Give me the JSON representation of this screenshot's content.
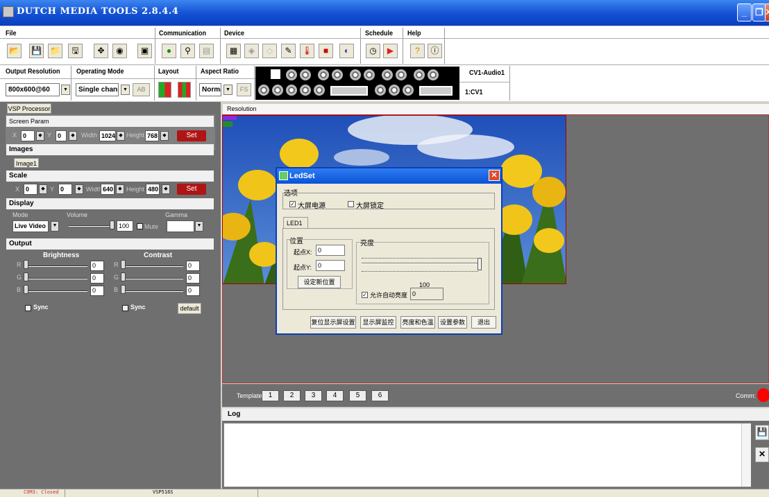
{
  "window": {
    "title": "DUTCH MEDIA TOOLS 2.8.4.4",
    "min": "_",
    "restore": "❐",
    "close": "X"
  },
  "toolbar_groups": {
    "file": "File",
    "communication": "Communication",
    "device": "Device",
    "schedule": "Schedule",
    "help": "Help"
  },
  "settings": {
    "output_resolution_label": "Output Resolution",
    "output_resolution_value": "800x600@60",
    "operating_mode_label": "Operating Mode",
    "operating_mode_value": "Single channel",
    "ab_button": "AB",
    "layout_label": "Layout",
    "aspect_ratio_label": "Aspect Ratio",
    "aspect_ratio_value": "Normal",
    "fs_button": "FS",
    "input_audio": "CV1-Audio1",
    "input_channel": "1:CV1"
  },
  "left": {
    "tab": "VSP Processor",
    "screen_param": "Screen Param",
    "x_label": "X",
    "x_value": "0",
    "y_label": "Y",
    "y_value": "0",
    "width_label": "Width",
    "width_value": "1024",
    "height_label": "Height",
    "height_value": "768",
    "set_label": "Set",
    "images": "Images",
    "image_tab": "Image1",
    "scale": "Scale",
    "scale_x": "0",
    "scale_y": "0",
    "scale_w": "640",
    "scale_h": "480",
    "display": "Display",
    "mode_label": "Mode",
    "mode_value": "Live Video",
    "volume_label": "Volume",
    "volume_value": "100",
    "mute_label": "Mute",
    "gamma_label": "Gamma",
    "output": "Output",
    "brightness": "Brightness",
    "contrast": "Contrast",
    "r": "R",
    "g": "G",
    "b": "B",
    "br_r": "0",
    "br_g": "0",
    "br_b": "0",
    "ct_r": "0",
    "ct_g": "0",
    "ct_b": "0",
    "sync": "Sync",
    "default_btn": "default"
  },
  "main": {
    "resolution_tab": "Resolution",
    "template_label": "Template:",
    "templates": [
      "1",
      "2",
      "3",
      "4",
      "5",
      "6"
    ],
    "comm_label": "Comm:",
    "log_label": "Log"
  },
  "dialog": {
    "title": "LedSet",
    "options_label": "选项",
    "opt1": "大屏电源",
    "opt2": "大屏锁定",
    "tab": "LED1",
    "position_label": "位置",
    "start_x_label": "起点X:",
    "start_x_value": "0",
    "start_y_label": "起点Y:",
    "start_y_value": "0",
    "set_position_btn": "设定新位置",
    "brightness_label": "亮度",
    "brightness_value": "100",
    "auto_brightness": "允许自动亮度",
    "auto_value": "0",
    "btn_reset": "复位显示屏设置",
    "btn_monitor": "显示屏监控",
    "btn_color": "亮度和色温",
    "btn_params": "设置参数",
    "btn_exit": "退出"
  },
  "status": {
    "port": "COM3: Closed",
    "device": "VSP516S"
  },
  "colors": {
    "titlebar": "#1552d4",
    "panel": "#6f6f6f",
    "set_button": "#b01414",
    "comm_indicator": "#ff0000"
  }
}
